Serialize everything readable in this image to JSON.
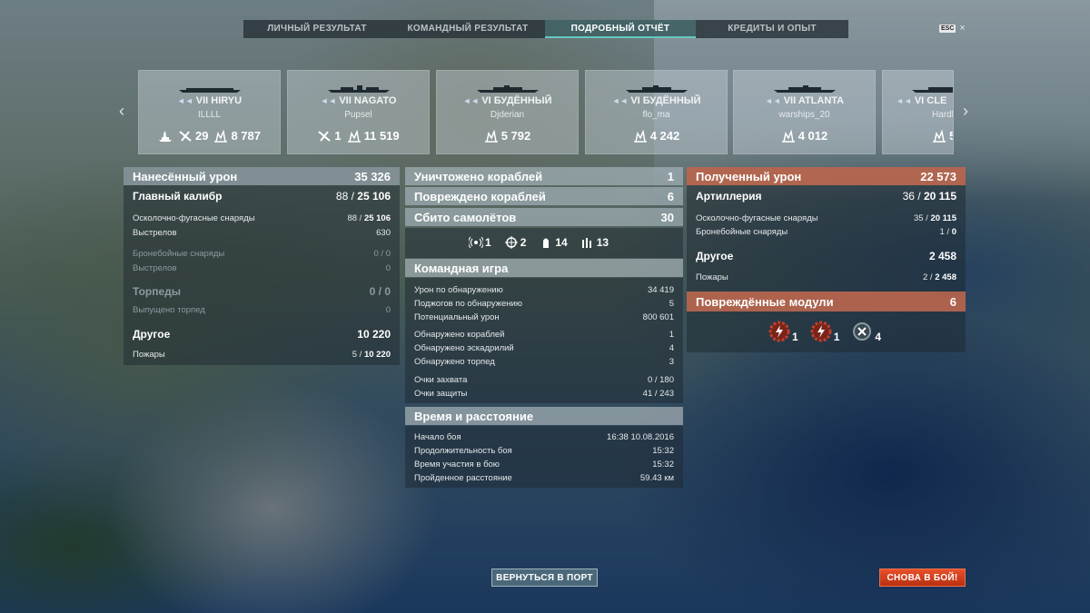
{
  "tabs": [
    {
      "label": "ЛИЧНЫЙ РЕЗУЛЬТАТ"
    },
    {
      "label": "КОМАНДНЫЙ РЕЗУЛЬТАТ"
    },
    {
      "label": "ПОДРОБНЫЙ ОТЧЁТ"
    },
    {
      "label": "КРЕДИТЫ И ОПЫТ"
    }
  ],
  "active_tab": 2,
  "esc": {
    "key": "ESC",
    "close": "×"
  },
  "ships": [
    {
      "tier": "VII",
      "name": "HIRYU",
      "player": "ILLLL",
      "planes": "29",
      "damage": "8 787",
      "icon": "carrier"
    },
    {
      "tier": "VII",
      "name": "NAGATO",
      "player": "Pupsel",
      "planes": "1",
      "damage": "11 519",
      "icon": "battleship"
    },
    {
      "tier": "VI",
      "name": "БУДЁННЫЙ",
      "player": "Djderian",
      "damage": "5 792",
      "icon": "cruiser"
    },
    {
      "tier": "VI",
      "name": "БУДЁННЫЙ",
      "player": "flo_ma",
      "damage": "4 242",
      "icon": "cruiser"
    },
    {
      "tier": "VII",
      "name": "ATLANTA",
      "player": "warships_20",
      "damage": "4 012",
      "icon": "cruiser"
    },
    {
      "tier": "VI",
      "name": "CLE",
      "player": "Hardl",
      "damage": "5",
      "icon": "cruiser"
    }
  ],
  "left": {
    "dealt_label": "Нанесённый урон",
    "dealt_value": "35 326",
    "main_label": "Главный калибр",
    "main_a": "88",
    "main_b": "25 106",
    "he_label": "Осколочно-фугасные снаряды",
    "he_a": "88",
    "he_b": "25 106",
    "he_shots_label": "Выстрелов",
    "he_shots": "630",
    "ap_label": "Бронебойные снаряды",
    "ap_value": "0 / 0",
    "ap_shots_label": "Выстрелов",
    "ap_shots": "0",
    "torp_label": "Торпеды",
    "torp_value": "0 / 0",
    "torp_fired_label": "Выпущено торпед",
    "torp_fired": "0",
    "other_label": "Другое",
    "other_value": "10 220",
    "fires_label": "Пожары",
    "fires_a": "5",
    "fires_b": "10 220"
  },
  "middle": {
    "destroyed_label": "Уничтожено кораблей",
    "destroyed": "1",
    "damaged_label": "Повреждено кораблей",
    "damaged": "6",
    "planes_label": "Сбито самолётов",
    "planes": "30",
    "icons": [
      {
        "name": "spotting-icon",
        "value": "1"
      },
      {
        "name": "crosshair-icon",
        "value": "2"
      },
      {
        "name": "shell-icon",
        "value": "14"
      },
      {
        "name": "shots-icon",
        "value": "13"
      }
    ],
    "team_header": "Командная игра",
    "team": [
      {
        "label": "Урон по обнаружению",
        "value": "34 419"
      },
      {
        "label": "Поджогов по обнаружению",
        "value": "5"
      },
      {
        "label": "Потенциальный урон",
        "value": "800 601"
      },
      {
        "label": "Обнаружено кораблей",
        "value": "1"
      },
      {
        "label": "Обнаружено эскадрилий",
        "value": "4"
      },
      {
        "label": "Обнаружено торпед",
        "value": "3"
      },
      {
        "label": "Очки захвата",
        "value": "0 / 180"
      },
      {
        "label": "Очки защиты",
        "value": "41 / 243"
      }
    ],
    "time_header": "Время и расстояние",
    "time": [
      {
        "label": "Начало боя",
        "value": "16:38  10.08.2016"
      },
      {
        "label": "Продолжительность боя",
        "value": "15:32"
      },
      {
        "label": "Время участия в бою",
        "value": "15:32"
      },
      {
        "label": "Пройденное расстояние",
        "value": "59.43 км"
      }
    ]
  },
  "right": {
    "received_label": "Полученный урон",
    "received_value": "22 573",
    "art_label": "Артиллерия",
    "art_a": "36",
    "art_b": "20 115",
    "he_label": "Осколочно-фугасные снаряды",
    "he_a": "35",
    "he_b": "20 115",
    "ap_label": "Бронебойные снаряды",
    "ap_a": "1",
    "ap_b": "0",
    "other_label": "Другое",
    "other_value": "2 458",
    "fires_label": "Пожары",
    "fires_a": "2",
    "fires_b": "2 458",
    "modules_label": "Повреждённые модули",
    "modules_value": "6",
    "modules": [
      {
        "name": "engine-damaged-icon",
        "value": "1"
      },
      {
        "name": "turret-damaged-icon",
        "value": "1"
      },
      {
        "name": "steering-icon",
        "value": "4"
      }
    ]
  },
  "buttons": {
    "port": "ВЕРНУТЬСЯ В ПОРТ",
    "again": "СНОВА В БОЙ!"
  },
  "colors": {
    "accent": "#68c8c0",
    "damage_header": "#d26e50",
    "battle_button": "#e8502a"
  }
}
